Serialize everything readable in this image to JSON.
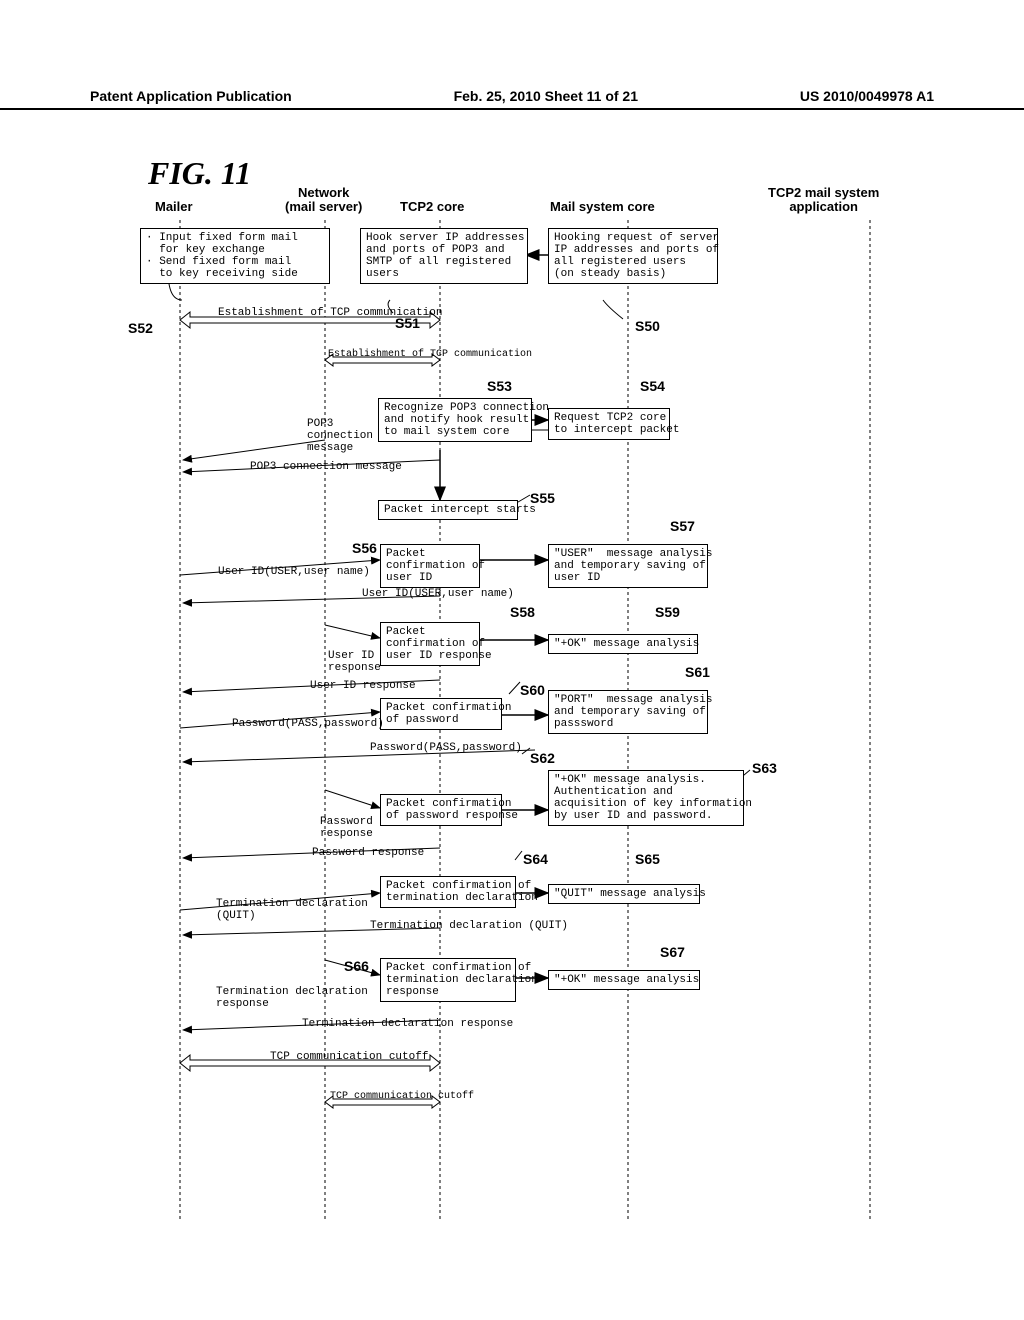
{
  "header": {
    "left": "Patent Application Publication",
    "center": "Feb. 25, 2010  Sheet 11 of 21",
    "right": "US 2010/0049978 A1"
  },
  "figure_label": "FIG. 11",
  "lanes": {
    "mailer": "Mailer",
    "network": "Network\n(mail server)",
    "tcp2core": "TCP2 core",
    "mailsys": "Mail system core",
    "app": "TCP2 mail system\napplication"
  },
  "boxes": {
    "b_mailer_input": "· Input fixed form mail\n  for key exchange\n· Send fixed form mail\n  to key receiving side",
    "b_s51": "Hook server IP addresses\nand ports of POP3 and\nSMTP of all registered\nusers",
    "b_s50": "Hooking request of server\nIP addresses and ports of\nall registered users\n(on steady basis)",
    "b_s53": "Recognize POP3 connection\nand notify hook result\nto mail system core",
    "b_s54": "Request TCP2 core\nto intercept packet",
    "b_s55": "Packet intercept starts",
    "b_s56": "Packet\nconfirmation of\nuser ID",
    "b_s57": "\"USER\"  message analysis\nand temporary saving of\nuser ID",
    "b_s58": "Packet\nconfirmation of\nuser ID response",
    "b_s59": "\"+OK\" message analysis",
    "b_s60": "Packet confirmation\nof password",
    "b_s61": "\"PORT\"  message analysis\nand temporary saving of\npasssword",
    "b_s62": "Packet confirmation\nof password response",
    "b_s63": "\"+OK\" message analysis.\nAuthentication and\nacquisition of key information\nby user ID and password.",
    "b_s64": "Packet confirmation of\ntermination declaration",
    "b_s65": "\"QUIT\" message analysis",
    "b_s66": "Packet confirmation of\ntermination declaration\nresponse",
    "b_s67": "\"+OK\" message analysis"
  },
  "msgs": {
    "m_estab_tcp1": "Establishment of TCP communication",
    "m_estab_tcp2": "Establishment of TCP communication",
    "m_pop3_conn": "POP3\nconnection\nmessage",
    "m_pop3_conn2": "POP3 connection message",
    "m_userid_out": "User ID(USER,user name)",
    "m_userid_in": "User ID(USER,user name)",
    "m_userid_resp1": "User ID\nresponse",
    "m_userid_resp2": "User ID response",
    "m_pass_out": "Password(PASS,password)",
    "m_pass_in": "Password(PASS,password)",
    "m_pass_resp1": "Password\nresponse",
    "m_pass_resp2": "Password response",
    "m_term_out": "Termination declaration\n(QUIT)",
    "m_term_in": "Termination declaration (QUIT)",
    "m_term_resp1": "Termination declaration\nresponse",
    "m_term_resp2": "Termination declaration response",
    "m_tcp_cut1": "TCP communication cutoff",
    "m_tcp_cut2": "TCP communication cutoff"
  },
  "steps": {
    "s50": "S50",
    "s51": "S51",
    "s52": "S52",
    "s53": "S53",
    "s54": "S54",
    "s55": "S55",
    "s56": "S56",
    "s57": "S57",
    "s58": "S58",
    "s59": "S59",
    "s60": "S60",
    "s61": "S61",
    "s62": "S62",
    "s63": "S63",
    "s64": "S64",
    "s65": "S65",
    "s66": "S66",
    "s67": "S67"
  }
}
